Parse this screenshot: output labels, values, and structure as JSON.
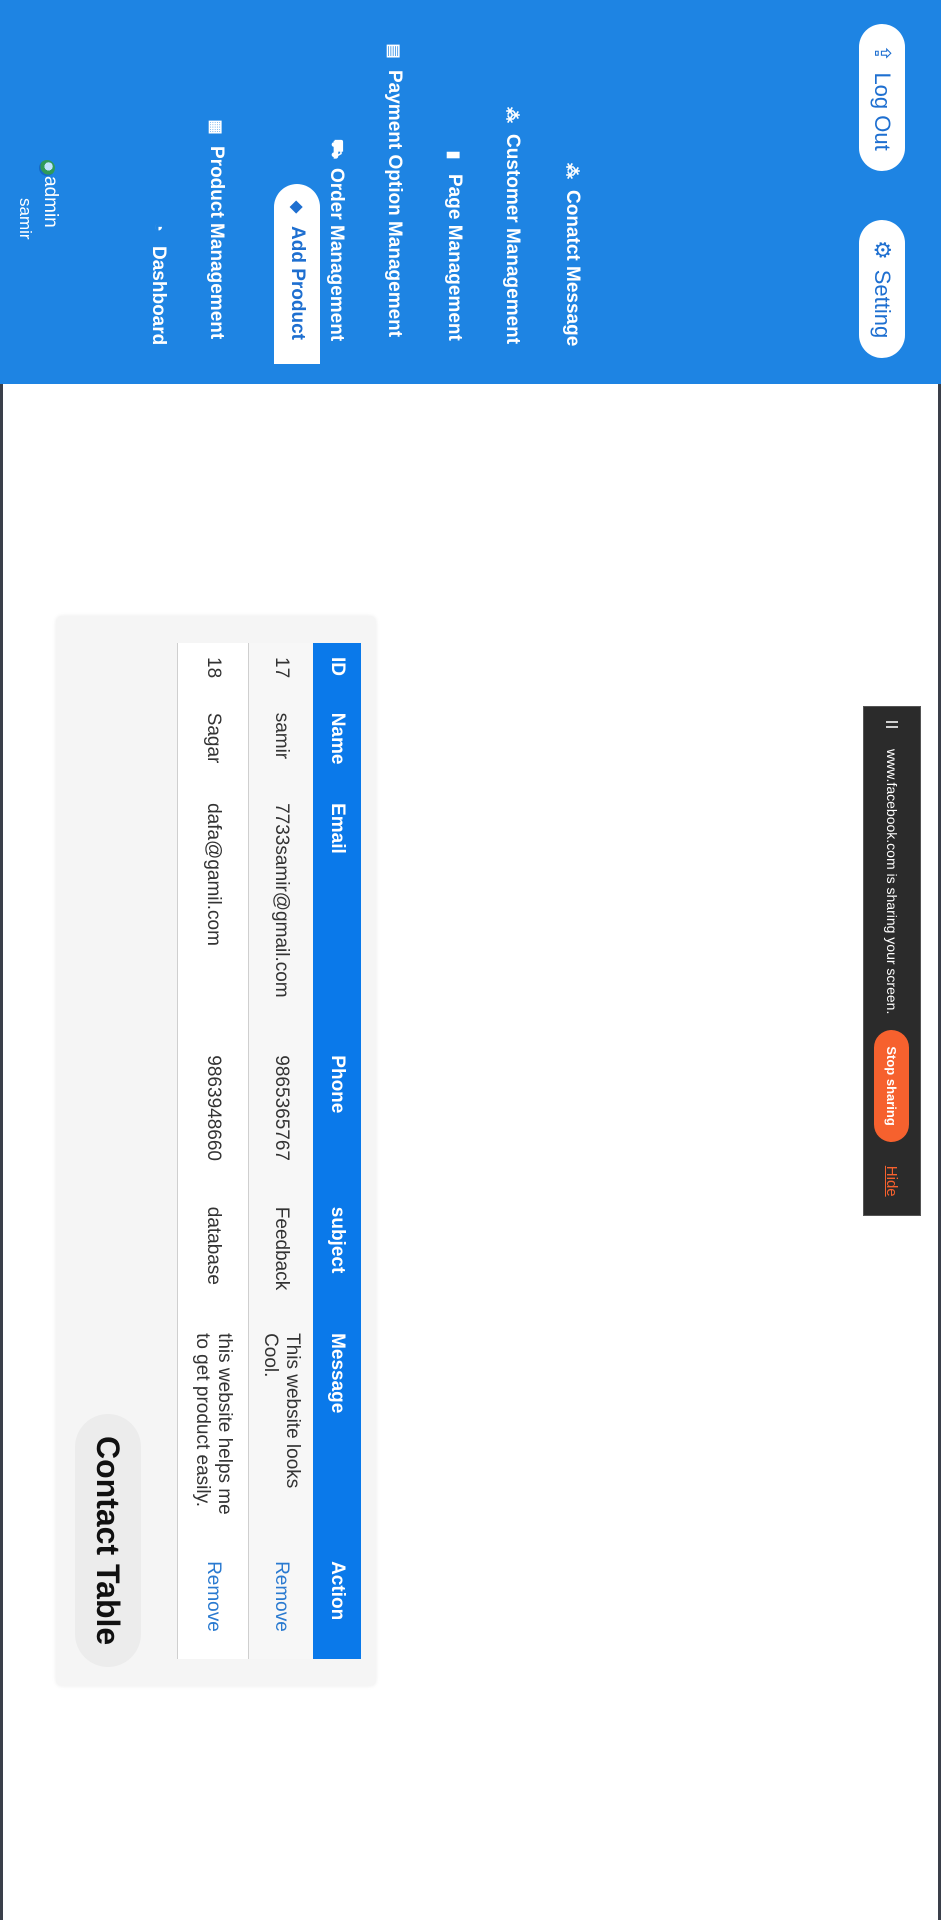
{
  "sidebar": {
    "user": {
      "role": "admin",
      "name": "samir"
    },
    "items": [
      {
        "label": "Dashboard",
        "icon": "dashboard-icon"
      },
      {
        "label": "Product Management",
        "icon": "boxes-icon"
      },
      {
        "label": "Add Product",
        "icon": "tag-icon",
        "active": true
      },
      {
        "label": "Order Management",
        "icon": "cart-icon"
      },
      {
        "label": "Payment Option Management",
        "icon": "credit-card-icon"
      },
      {
        "label": "Page Management",
        "icon": "file-icon"
      },
      {
        "label": "Customer Management",
        "icon": "users-icon"
      },
      {
        "label": "Conatct Message",
        "icon": "users-icon"
      }
    ],
    "setting_label": "Setting",
    "logout_label": "Log Out"
  },
  "contact": {
    "title": "Contact Table",
    "columns": [
      "ID",
      "Name",
      "Email",
      "Phone",
      "subject",
      "Message",
      "Action"
    ],
    "rows": [
      {
        "id": "17",
        "name": "samir",
        "email": "7733samir@gmail.com",
        "phone": "9865365767",
        "subject": "Feedback",
        "message": "This website looks Cool.",
        "action": "Remove"
      },
      {
        "id": "18",
        "name": "Sagar",
        "email": "dafa@gamil.com",
        "phone": "9863948660",
        "subject": "database",
        "message": "this website helps me to get product easily.",
        "action": "Remove"
      }
    ]
  },
  "share_bar": {
    "message": "www.facebook.com is sharing your screen.",
    "stop_label": "Stop sharing",
    "hide_label": "Hide"
  },
  "colors": {
    "primary": "#1e84e3",
    "header": "#0a79ea",
    "stop": "#f6612e"
  }
}
